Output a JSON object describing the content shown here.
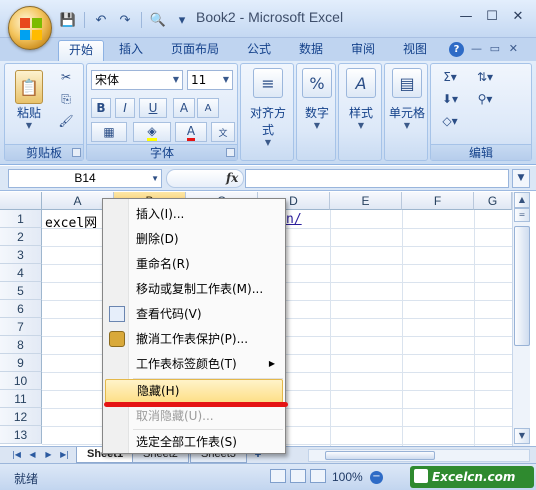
{
  "window": {
    "title": "Book2 - Microsoft Excel",
    "controls": {
      "minimize": "—",
      "maximize": "☐",
      "close": "✕"
    }
  },
  "quick_access": {
    "save": "💾",
    "undo": "↶",
    "redo": "↷",
    "preview": "🔍",
    "customize": "▾"
  },
  "ribbon": {
    "tabs": [
      "开始",
      "插入",
      "页面布局",
      "公式",
      "数据",
      "审阅",
      "视图"
    ],
    "active_tab": "开始",
    "groups": {
      "clipboard": {
        "label": "剪贴板",
        "paste_label": "粘贴"
      },
      "font": {
        "label": "字体",
        "font_name": "宋体",
        "font_size": "11",
        "bold": "B",
        "italic": "I",
        "underline": "U",
        "grow": "A",
        "shrink": "A"
      },
      "alignment": {
        "label": "对齐方式"
      },
      "number": {
        "label": "数字",
        "symbol": "%"
      },
      "styles": {
        "label": "样式",
        "symbol": "A"
      },
      "cells": {
        "label": "单元格"
      },
      "editing": {
        "label": "编辑",
        "sum": "Σ"
      }
    },
    "help": "?"
  },
  "formula_bar": {
    "name_box": "B14",
    "fx": "fx",
    "formula": ""
  },
  "grid": {
    "columns": [
      "A",
      "B",
      "C",
      "D",
      "E",
      "F",
      "G"
    ],
    "rows": [
      "1",
      "2",
      "3",
      "4",
      "5",
      "6",
      "7",
      "8",
      "9",
      "10",
      "11",
      "12",
      "13"
    ],
    "cells": {
      "A1": "excel网",
      "D1_link": "n/"
    }
  },
  "context_menu": {
    "items": [
      {
        "label": "插入(I)...",
        "state": "normal"
      },
      {
        "label": "删除(D)",
        "state": "normal"
      },
      {
        "label": "重命名(R)",
        "state": "normal"
      },
      {
        "label": "移动或复制工作表(M)...",
        "state": "normal"
      },
      {
        "label": "查看代码(V)",
        "state": "normal"
      },
      {
        "label": "撤消工作表保护(P)...",
        "state": "normal"
      },
      {
        "label": "工作表标签颜色(T)",
        "state": "submenu"
      },
      {
        "label": "隐藏(H)",
        "state": "hover"
      },
      {
        "label": "取消隐藏(U)...",
        "state": "disabled"
      },
      {
        "label": "选定全部工作表(S)",
        "state": "normal"
      }
    ]
  },
  "sheet_tabs": [
    "Sheet1",
    "Sheet2",
    "Sheet3"
  ],
  "status_bar": {
    "ready": "就绪",
    "zoom": "100%",
    "watermark": "Excelcn.com"
  },
  "colors": {
    "accent": "#15428b",
    "highlight": "#fddf87",
    "annotation_line": "#e51414"
  }
}
